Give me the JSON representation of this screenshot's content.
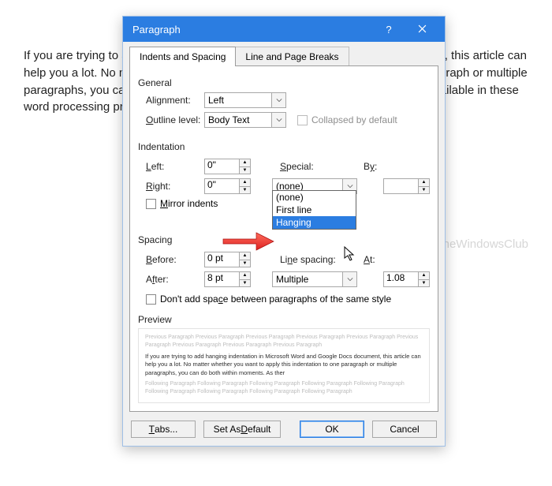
{
  "backdoc": {
    "text": "If you are trying to add hanging indentation in a hanging indentation in document, this article can help you a lot. No matter whether you want to apply this indentation to one paragraph or multiple paragraphs, you can do both within moments. As there is no one-click button available in these word processing programs, you need to go through about the steps here."
  },
  "dialog": {
    "title": "Paragraph",
    "tabs": [
      "Indents and Spacing",
      "Line and Page Breaks"
    ],
    "general": {
      "heading": "General",
      "alignment_label": "Alignment:",
      "alignment_value": "Left",
      "outline_label": "Outline level:",
      "outline_value": "Body Text",
      "collapsed_label": "Collapsed by default"
    },
    "indentation": {
      "heading": "Indentation",
      "left_label": "Left:",
      "left_value": "0\"",
      "right_label": "Right:",
      "right_value": "0\"",
      "mirror_label": "Mirror indents",
      "special_label": "Special:",
      "special_value": "(none)",
      "special_options": [
        "(none)",
        "First line",
        "Hanging"
      ],
      "by_label": "By:",
      "by_value": ""
    },
    "spacing": {
      "heading": "Spacing",
      "before_label": "Before:",
      "before_value": "0 pt",
      "after_label": "After:",
      "after_value": "8 pt",
      "noadd_label": "Don't add space between paragraphs of the same style",
      "line_label": "Line spacing:",
      "line_value": "Multiple",
      "at_label": "At:",
      "at_value": "1.08"
    },
    "preview": {
      "heading": "Preview",
      "faded": "Previous Paragraph Previous Paragraph Previous Paragraph Previous Paragraph Previous Paragraph Previous Paragraph Previous Paragraph Previous Paragraph Previous Paragraph",
      "main": "If you are trying to add hanging indentation in Microsoft Word and Google Docs document, this article can help you a lot. No matter whether you want to apply this indentation to one paragraph or multiple paragraphs, you can do both within moments. As ther",
      "faded2": "Following Paragraph Following Paragraph Following Paragraph Following Paragraph Following Paragraph Following Paragraph Following Paragraph Following Paragraph Following Paragraph"
    },
    "buttons": {
      "tabs": "Tabs...",
      "default": "Set As Default",
      "ok": "OK",
      "cancel": "Cancel"
    }
  },
  "watermark": "TheWindowsClub"
}
